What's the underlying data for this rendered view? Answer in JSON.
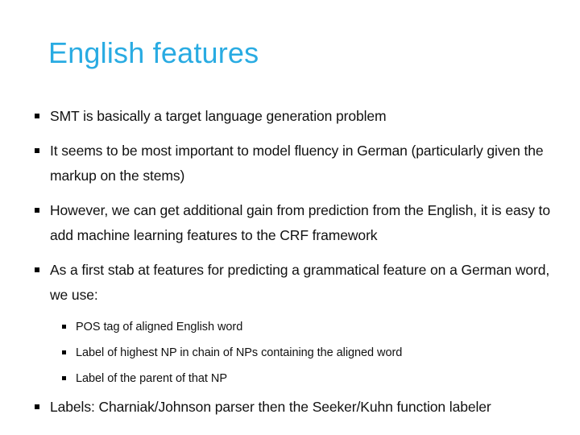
{
  "slide": {
    "title": "English features",
    "title_color": "#29abe2",
    "background_color": "#ffffff",
    "text_color": "#111111",
    "bullet_marker_glyph": "square",
    "bullets": [
      {
        "level": 1,
        "text": "SMT is basically a target language generation problem"
      },
      {
        "level": 1,
        "text": "It seems to be most important to model fluency in German (particularly given the markup on the stems)"
      },
      {
        "level": 1,
        "text": "However, we can get additional gain from prediction from the English, it is easy to add machine learning features to the CRF framework"
      },
      {
        "level": 1,
        "text": "As a first stab at features for predicting a grammatical feature on a German word, we use:"
      },
      {
        "level": 2,
        "text": "POS tag of aligned English word"
      },
      {
        "level": 2,
        "text": "Label of highest NP in chain of NPs containing the aligned word"
      },
      {
        "level": 2,
        "text": "Label of the parent of that NP"
      },
      {
        "level": 1,
        "text": "Labels: Charniak/Johnson parser then the Seeker/Kuhn function labeler"
      }
    ]
  }
}
